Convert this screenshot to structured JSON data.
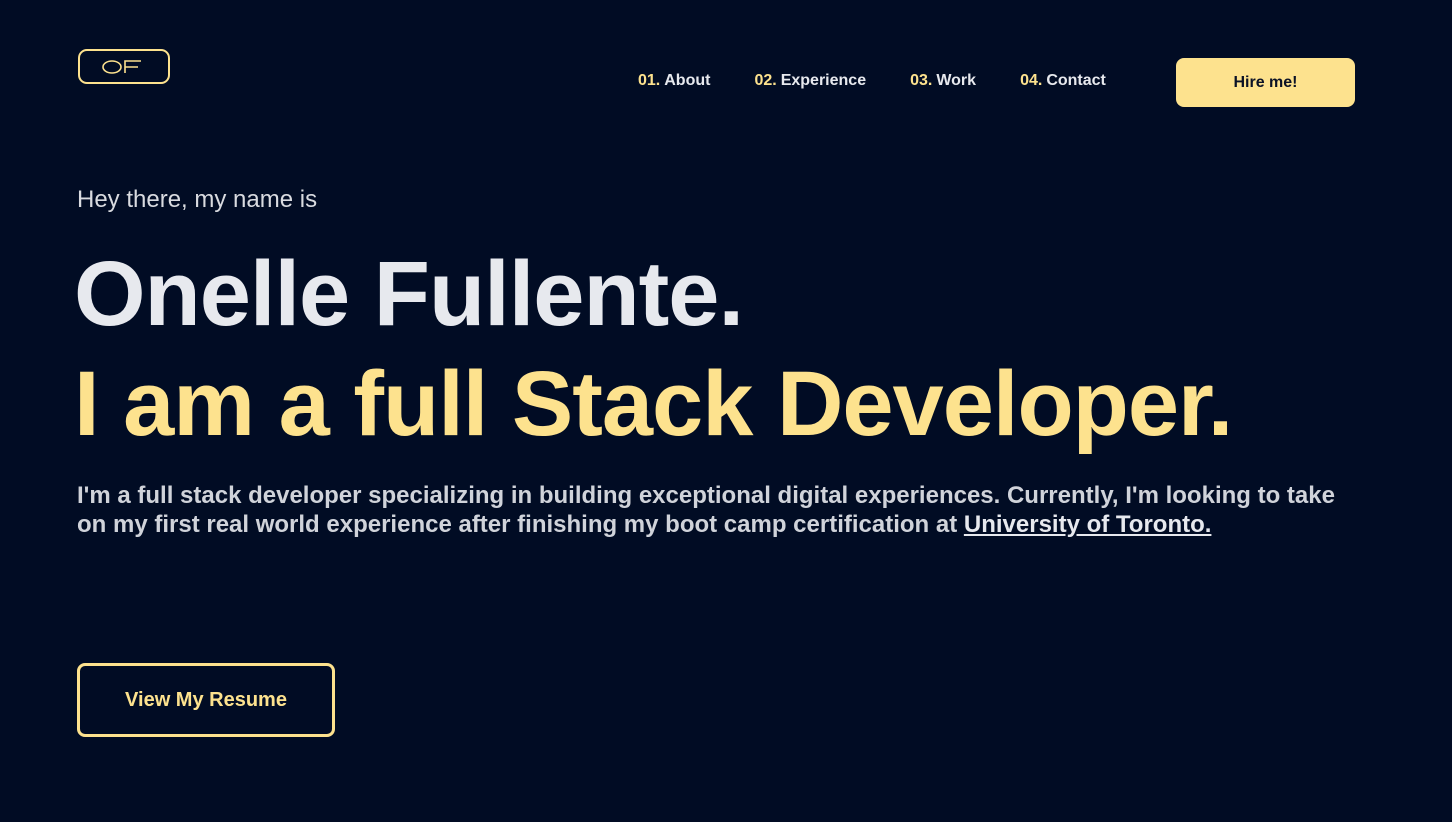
{
  "header": {
    "logo_text": "OF",
    "nav": [
      {
        "num": "01.",
        "label": "About"
      },
      {
        "num": "02.",
        "label": "Experience"
      },
      {
        "num": "03.",
        "label": "Work"
      },
      {
        "num": "04.",
        "label": "Contact"
      }
    ],
    "hire_label": "Hire me!"
  },
  "hero": {
    "greeting": "Hey there, my name is",
    "name": "Onelle Fullente.",
    "role": "I am a full Stack Developer.",
    "bio": "I'm a full stack developer specializing in building exceptional digital experiences. Currently, I'm looking to take on my first real world experience after finishing my boot camp certification at ",
    "bio_link": "University of Toronto.",
    "resume_label": "View My Resume"
  },
  "colors": {
    "background": "#010c24",
    "accent": "#fde28e",
    "text": "#e7e9ee"
  }
}
